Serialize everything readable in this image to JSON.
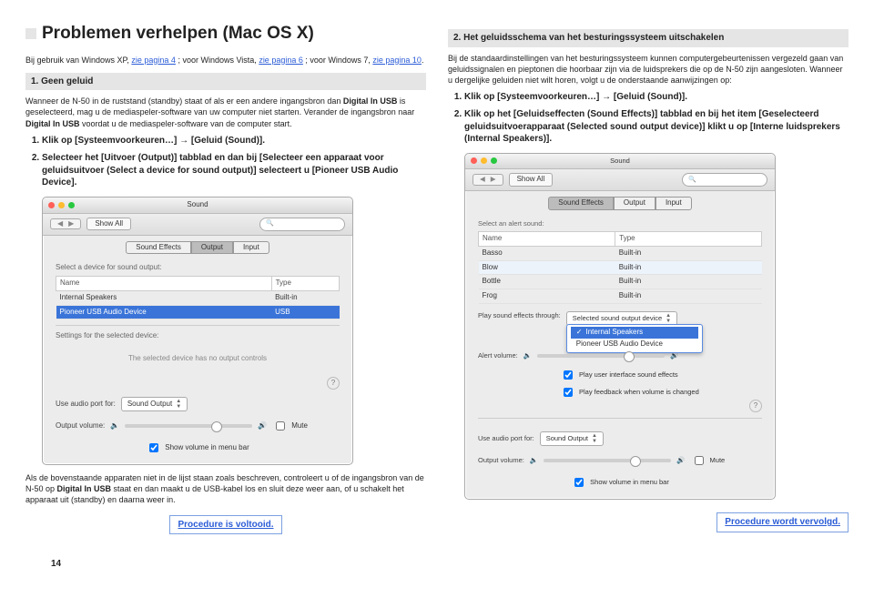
{
  "page": {
    "title": "Problemen verhelpen (Mac OS X)",
    "intro_prefix": "Bij gebruik van Windows XP, ",
    "link1": "zie pagina 4",
    "intro_mid1": " ; voor Windows Vista, ",
    "link2": "zie pagina 6",
    "intro_mid2": " ; voor Windows 7, ",
    "link3": "zie pagina 10",
    "intro_end": "."
  },
  "left": {
    "section1_title": "1. Geen geluid",
    "p1a": "Wanneer de N-50 in de ruststand (standby) staat of als er een andere ingangsbron dan ",
    "p1b": "Digital In USB",
    "p1c": " is geselecteerd, mag u de mediaspeler-software van uw computer niet starten. Verander de ingangsbron naar ",
    "p1d": "Digital In USB",
    "p1e": " voordat u de mediaspeler-software van de computer start.",
    "step1": "Klik op [Systeemvoorkeuren…] → [Geluid (Sound)].",
    "step2": "Selecteer het [Uitvoer (Output)] tabblad en dan bij [Selecteer een apparaat voor geluidsuitvoer (Select a device for sound output)] selecteert u [Pioneer USB Audio Device].",
    "bottom_para_a": "Als de bovenstaande apparaten niet in de lijst staan zoals beschreven, controleert u of de ingangsbron van de N-50 op ",
    "bottom_para_b": "Digital In USB",
    "bottom_para_c": " staat en dan maakt u de USB-kabel los en sluit deze weer aan, of u schakelt het apparaat uit (standby) en daarna weer in.",
    "proc_done": "Procedure is voltooid."
  },
  "right": {
    "section2_title": "2. Het geluidsschema van het besturingssysteem uitschakelen",
    "p2": "Bij de standaardinstellingen van het besturingssysteem kunnen computergebeurtenissen vergezeld gaan van geluidssignalen en pieptonen die hoorbaar zijn via de luidsprekers die op de N-50 zijn aangesloten. Wanneer u dergelijke geluiden niet wilt horen, volgt u de onderstaande aanwijzingen op:",
    "step1": "Klik op [Systeemvoorkeuren…] → [Geluid (Sound)].",
    "step2": "Klik op het [Geluidseffecten (Sound Effects)] tabblad en bij het item [Geselecteerd geluidsuitvoerapparaat (Selected sound output device)] klikt u op [Interne luidsprekers (Internal Speakers)].",
    "proc_cont": "Procedure wordt vervolgd."
  },
  "macwin": {
    "title": "Sound",
    "show_all": "Show All",
    "tab_effects": "Sound Effects",
    "tab_output": "Output",
    "tab_input": "Input",
    "sel_device_label": "Select a device for sound output:",
    "col_name": "Name",
    "col_type": "Type",
    "row1_name": "Internal Speakers",
    "row1_type": "Built-in",
    "row2_name": "Pioneer USB Audio Device",
    "row2_type": "USB",
    "settings_label": "Settings for the selected device:",
    "no_controls": "The selected device has no output controls",
    "audio_port_label": "Use audio port for:",
    "audio_port_value": "Sound Output",
    "output_vol_label": "Output volume:",
    "mute_label": "Mute",
    "menubar_label": "Show volume in menu bar",
    "alert_label": "Select an alert sound:",
    "alert_rows": [
      "Basso",
      "Blow",
      "Bottle",
      "Frog"
    ],
    "alert_type": "Built-in",
    "play_through_label": "Play sound effects through:",
    "selected_output": "Selected sound output device",
    "popup_internal": "Internal Speakers",
    "popup_pioneer": "Pioneer USB Audio Device",
    "alert_vol_label": "Alert volume:",
    "chk_ui": "Play user interface sound effects",
    "chk_feedback": "Play feedback when volume is changed"
  },
  "footer": {
    "page_number": "14"
  }
}
